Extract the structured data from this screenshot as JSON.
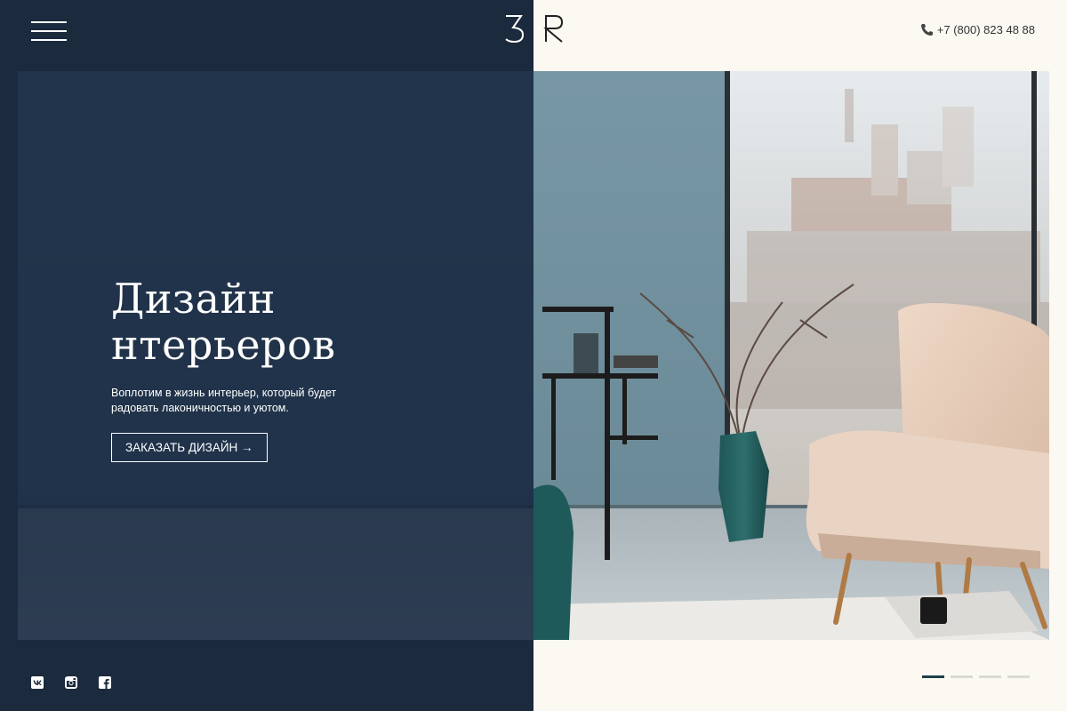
{
  "header": {
    "menu_icon": "hamburger-icon",
    "logo_text": "BR",
    "phone": {
      "icon": "phone-icon",
      "number": "+7 (800) 823 48 88"
    }
  },
  "hero": {
    "title_line1": "Дизайн",
    "title_line2": "нтерьеров",
    "subtitle": "Воплотим в жизнь интерьер, который будет радовать лаконичностью и уютом.",
    "cta_label": "ЗАКАЗАТЬ ДИЗАЙН →"
  },
  "footer": {
    "socials": [
      {
        "name": "vk",
        "icon": "vk-icon"
      },
      {
        "name": "instagram",
        "icon": "instagram-icon"
      },
      {
        "name": "facebook",
        "icon": "facebook-icon"
      }
    ],
    "slider": {
      "total": 4,
      "active": 1
    }
  },
  "colors": {
    "dark_panel": "#1b2a3d",
    "overlay": "#14243c",
    "light_bg": "#fcf9f3",
    "accent_dot": "#1e3f4a"
  }
}
